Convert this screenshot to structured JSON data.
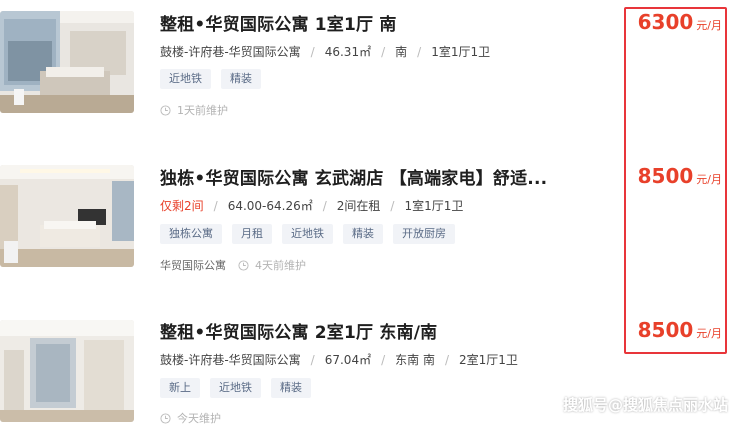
{
  "listings": [
    {
      "title": "整租•华贸国际公寓 1室1厅 南",
      "meta": [
        "鼓楼-许府巷-华贸国际公寓",
        "46.31㎡",
        "南",
        "1室1厅1卫"
      ],
      "tags": [
        "近地铁",
        "精装"
      ],
      "agent": "",
      "updated": "1天前维护",
      "price": "6300",
      "price_unit": "元/月"
    },
    {
      "title": "独栋•华贸国际公寓 玄武湖店 【高端家电】舒适...",
      "hot": "仅剩2间",
      "meta": [
        "64.00-64.26㎡",
        "2间在租",
        "1室1厅1卫"
      ],
      "tags": [
        "独栋公寓",
        "月租",
        "近地铁",
        "精装",
        "开放厨房"
      ],
      "agent": "华贸国际公寓",
      "updated": "4天前维护",
      "price": "8500",
      "price_unit": "元/月"
    },
    {
      "title": "整租•华贸国际公寓 2室1厅 东南/南",
      "meta": [
        "鼓楼-许府巷-华贸国际公寓",
        "67.04㎡",
        "东南 南",
        "2室1厅1卫"
      ],
      "tags": [
        "新上",
        "近地铁",
        "精装"
      ],
      "agent": "",
      "updated": "今天维护",
      "price": "8500",
      "price_unit": "元/月"
    }
  ],
  "watermark": "搜狐号@搜狐焦点丽水站",
  "colors": {
    "accent": "#e8402a",
    "box": "#e8353a",
    "tag_bg": "#f1f3f7",
    "tag_text": "#5a6b86"
  }
}
